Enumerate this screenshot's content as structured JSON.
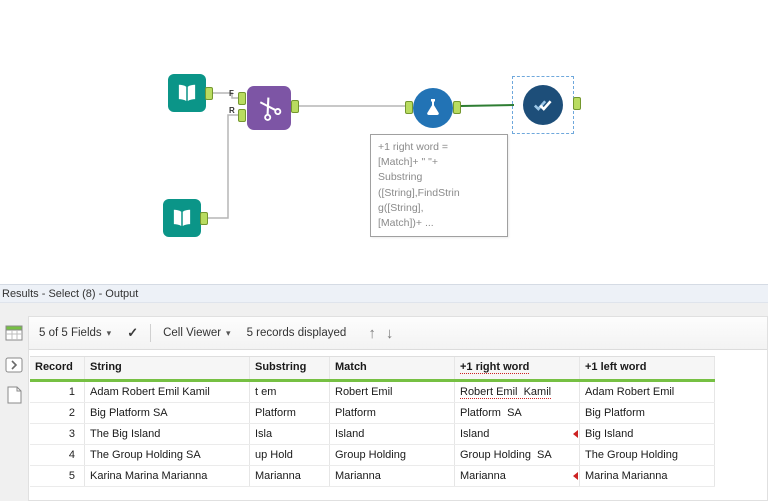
{
  "canvas": {
    "annotation_text": "+1 right word =\n[Match]+ \" \"+\nSubstring\n([String],FindStrin\ng([String],\n[Match])+ ...",
    "anchor_labels": {
      "find": "F",
      "replace": "R"
    },
    "tools": [
      {
        "name": "text-input-1",
        "icon": "open-book"
      },
      {
        "name": "text-input-2",
        "icon": "open-book"
      },
      {
        "name": "find-replace",
        "icon": "scissors"
      },
      {
        "name": "formula",
        "icon": "flask"
      },
      {
        "name": "select",
        "icon": "double-check"
      }
    ]
  },
  "results": {
    "title": "Results - Select (8) - Output",
    "toolbar": {
      "fields_summary": "5 of 5 Fields",
      "cell_viewer_label": "Cell Viewer",
      "records_displayed": "5 records displayed"
    },
    "icons": {
      "caret": "▾",
      "check": "✓",
      "up": "↑",
      "down": "↓"
    },
    "table": {
      "columns": [
        "Record",
        "String",
        "Substring",
        "Match",
        "+1 right word",
        "+1 left word"
      ],
      "header_flags": [
        null,
        null,
        null,
        null,
        "underline",
        null
      ],
      "rows": [
        {
          "cells": [
            "1",
            "Adam Robert Emil Kamil",
            "t em",
            "Robert Emil",
            "Robert Emil  Kamil",
            "Adam Robert Emil"
          ],
          "cell_flags": [
            null,
            null,
            null,
            null,
            "underline",
            null
          ]
        },
        {
          "cells": [
            "2",
            "Big Platform SA",
            "Platform",
            "Platform",
            "Platform  SA",
            "Big Platform"
          ],
          "cell_flags": [
            null,
            null,
            null,
            null,
            null,
            null
          ]
        },
        {
          "cells": [
            "3",
            "The Big Island",
            "Isla",
            "Island",
            "Island",
            "Big Island"
          ],
          "cell_flags": [
            null,
            null,
            null,
            null,
            "triangle",
            null
          ]
        },
        {
          "cells": [
            "4",
            "The Group Holding SA",
            "up Hold",
            "Group Holding",
            "Group Holding  SA",
            "The Group Holding"
          ],
          "cell_flags": [
            null,
            null,
            null,
            null,
            null,
            null
          ]
        },
        {
          "cells": [
            "5",
            "Karina Marina Marianna",
            "Marianna",
            "Marianna",
            "Marianna",
            "Marina Marianna"
          ],
          "cell_flags": [
            null,
            null,
            null,
            null,
            "triangle",
            null
          ]
        }
      ]
    }
  },
  "colors": {
    "tool_teal": "#0b9588",
    "tool_purple": "#7d55a5",
    "tool_blue": "#2273b5",
    "tool_navy": "#1d4e79",
    "anchor_green": "#b9dc60",
    "wire_gray": "#b5b5b5",
    "wire_selected": "#2e7d32",
    "header_underline_green": "#76c043",
    "warning_red": "#cc2222"
  }
}
